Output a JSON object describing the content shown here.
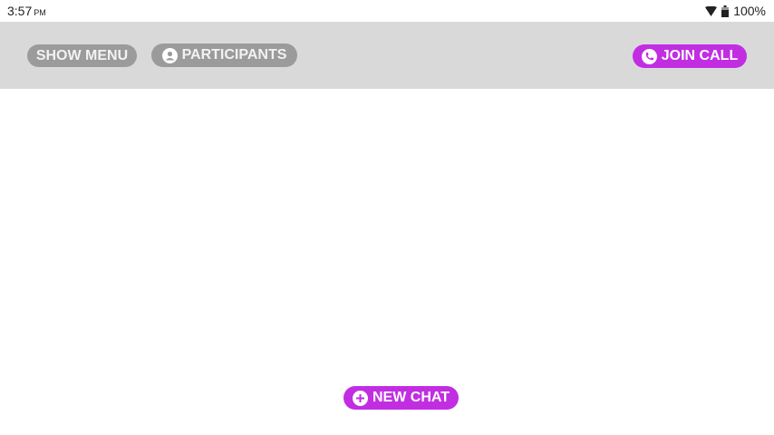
{
  "status_bar": {
    "time": "3:57",
    "ampm": "PM",
    "battery": "100%"
  },
  "header": {
    "show_menu": "SHOW MENU",
    "participants": "PARTICIPANTS",
    "join_call": "JOIN CALL"
  },
  "main": {
    "new_chat": "NEW CHAT"
  },
  "colors": {
    "accent": "#c12ee2",
    "header_bg": "#d9d9d9",
    "grey_button": "#9b9b9b"
  }
}
